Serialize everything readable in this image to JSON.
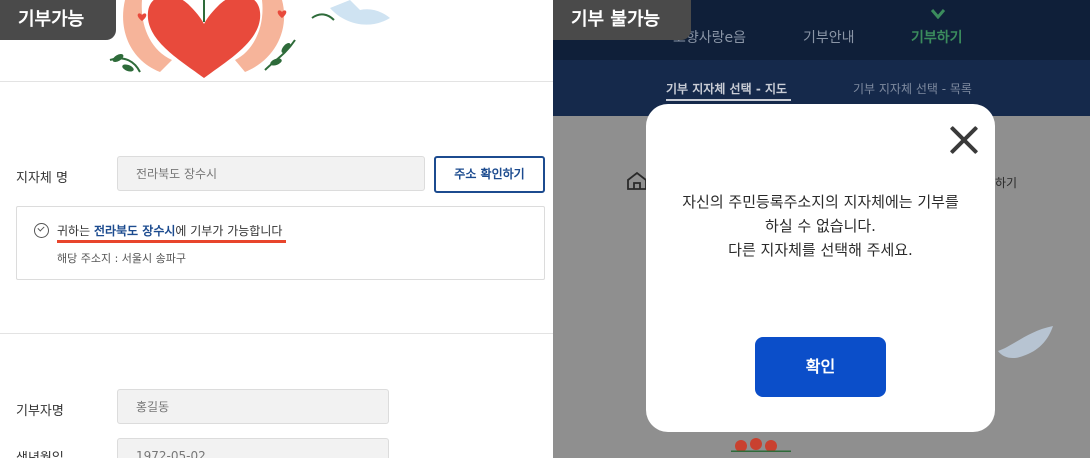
{
  "left_tag": "기부가능",
  "right_tag": "기부 불가능",
  "form": {
    "region_label": "지자체 명",
    "region_value": "전라북도 장수시",
    "address_button": "주소 확인하기",
    "notice_prefix": "귀하는 ",
    "notice_region": "전라북도 장수시",
    "notice_suffix": "에 기부가 가능합니다",
    "notice_address": "해당 주소지 : 서울시 송파구",
    "donor_label": "기부자명",
    "donor_value": "홍길동",
    "birth_label": "생년월일",
    "birth_value": "1972-05-02"
  },
  "nav": {
    "items": [
      "고향사랑e음",
      "기부안내",
      "기부하기"
    ],
    "active": "기부하기"
  },
  "subnav": {
    "map": "기부 지자체 선택 - 지도",
    "list": "기부 지자체 선택 - 목록"
  },
  "background_fragment": "하기",
  "modal": {
    "message_line1": "자신의 주민등록주소지의 지자체에는 기부를",
    "message_line2": "하실 수 없습니다.",
    "message_line3": "다른 지자체를 선택해 주세요.",
    "confirm_button": "확인"
  },
  "colors": {
    "accent_blue": "#1c4b8f",
    "confirm_blue": "#0b4ec9",
    "highlight_red": "#e8452c",
    "nav_dark": "#0f1f39",
    "tag_gray": "#4a4a4a"
  }
}
